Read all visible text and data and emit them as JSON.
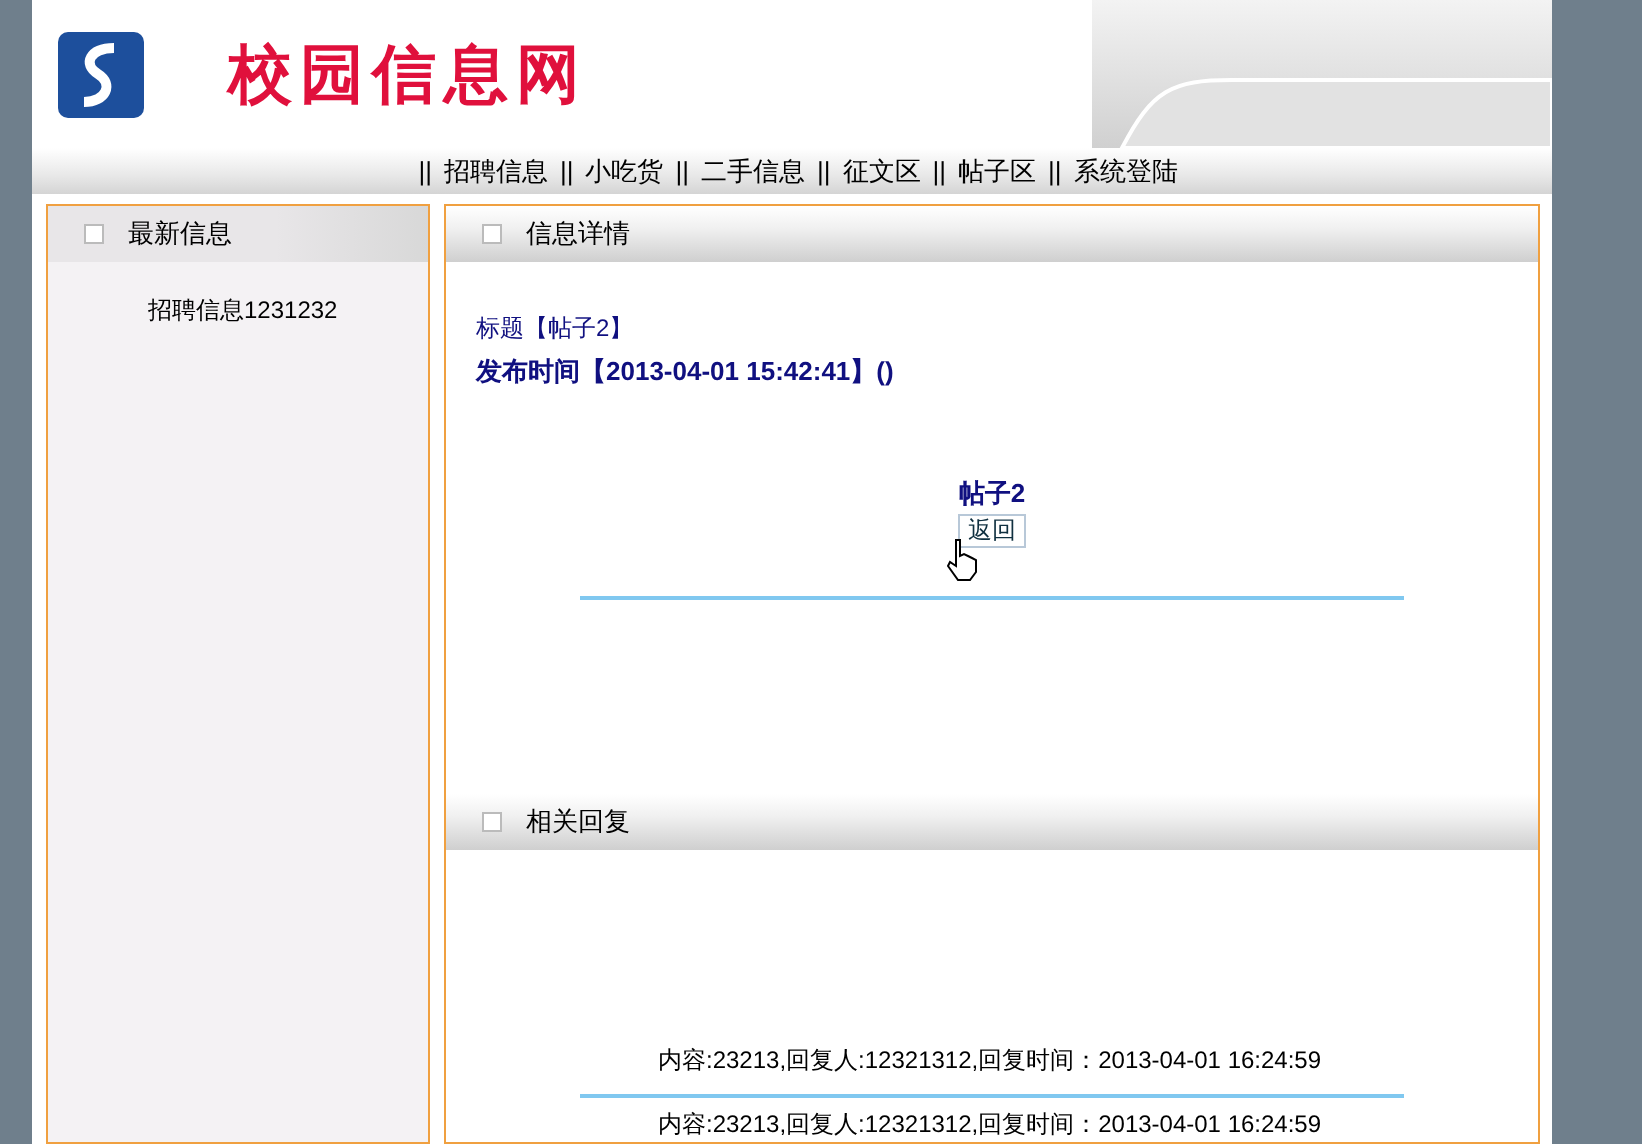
{
  "header": {
    "site_title": "校园信息网"
  },
  "nav": [
    {
      "separator": "||",
      "label": "招聘信息"
    },
    {
      "separator": "||",
      "label": "小吃货"
    },
    {
      "separator": "||",
      "label": "二手信息"
    },
    {
      "separator": "||",
      "label": "征文区"
    },
    {
      "separator": "||",
      "label": "帖子区"
    },
    {
      "separator": "||",
      "label": "系统登陆"
    }
  ],
  "sidebar": {
    "title": "最新信息",
    "items": [
      "招聘信息1231232"
    ]
  },
  "detail": {
    "title": "信息详情",
    "post_title": "标题【帖子2】",
    "post_time": "发布时间【2013-04-01 15:42:41】()",
    "post_heading": "帖子2",
    "back_button": "返回"
  },
  "replies": {
    "title": "相关回复",
    "items": [
      "内容:23213,回复人:12321312,回复时间：2013-04-01 16:24:59",
      "内容:23213,回复人:12321312,回复时间：2013-04-01 16:24:59"
    ]
  }
}
